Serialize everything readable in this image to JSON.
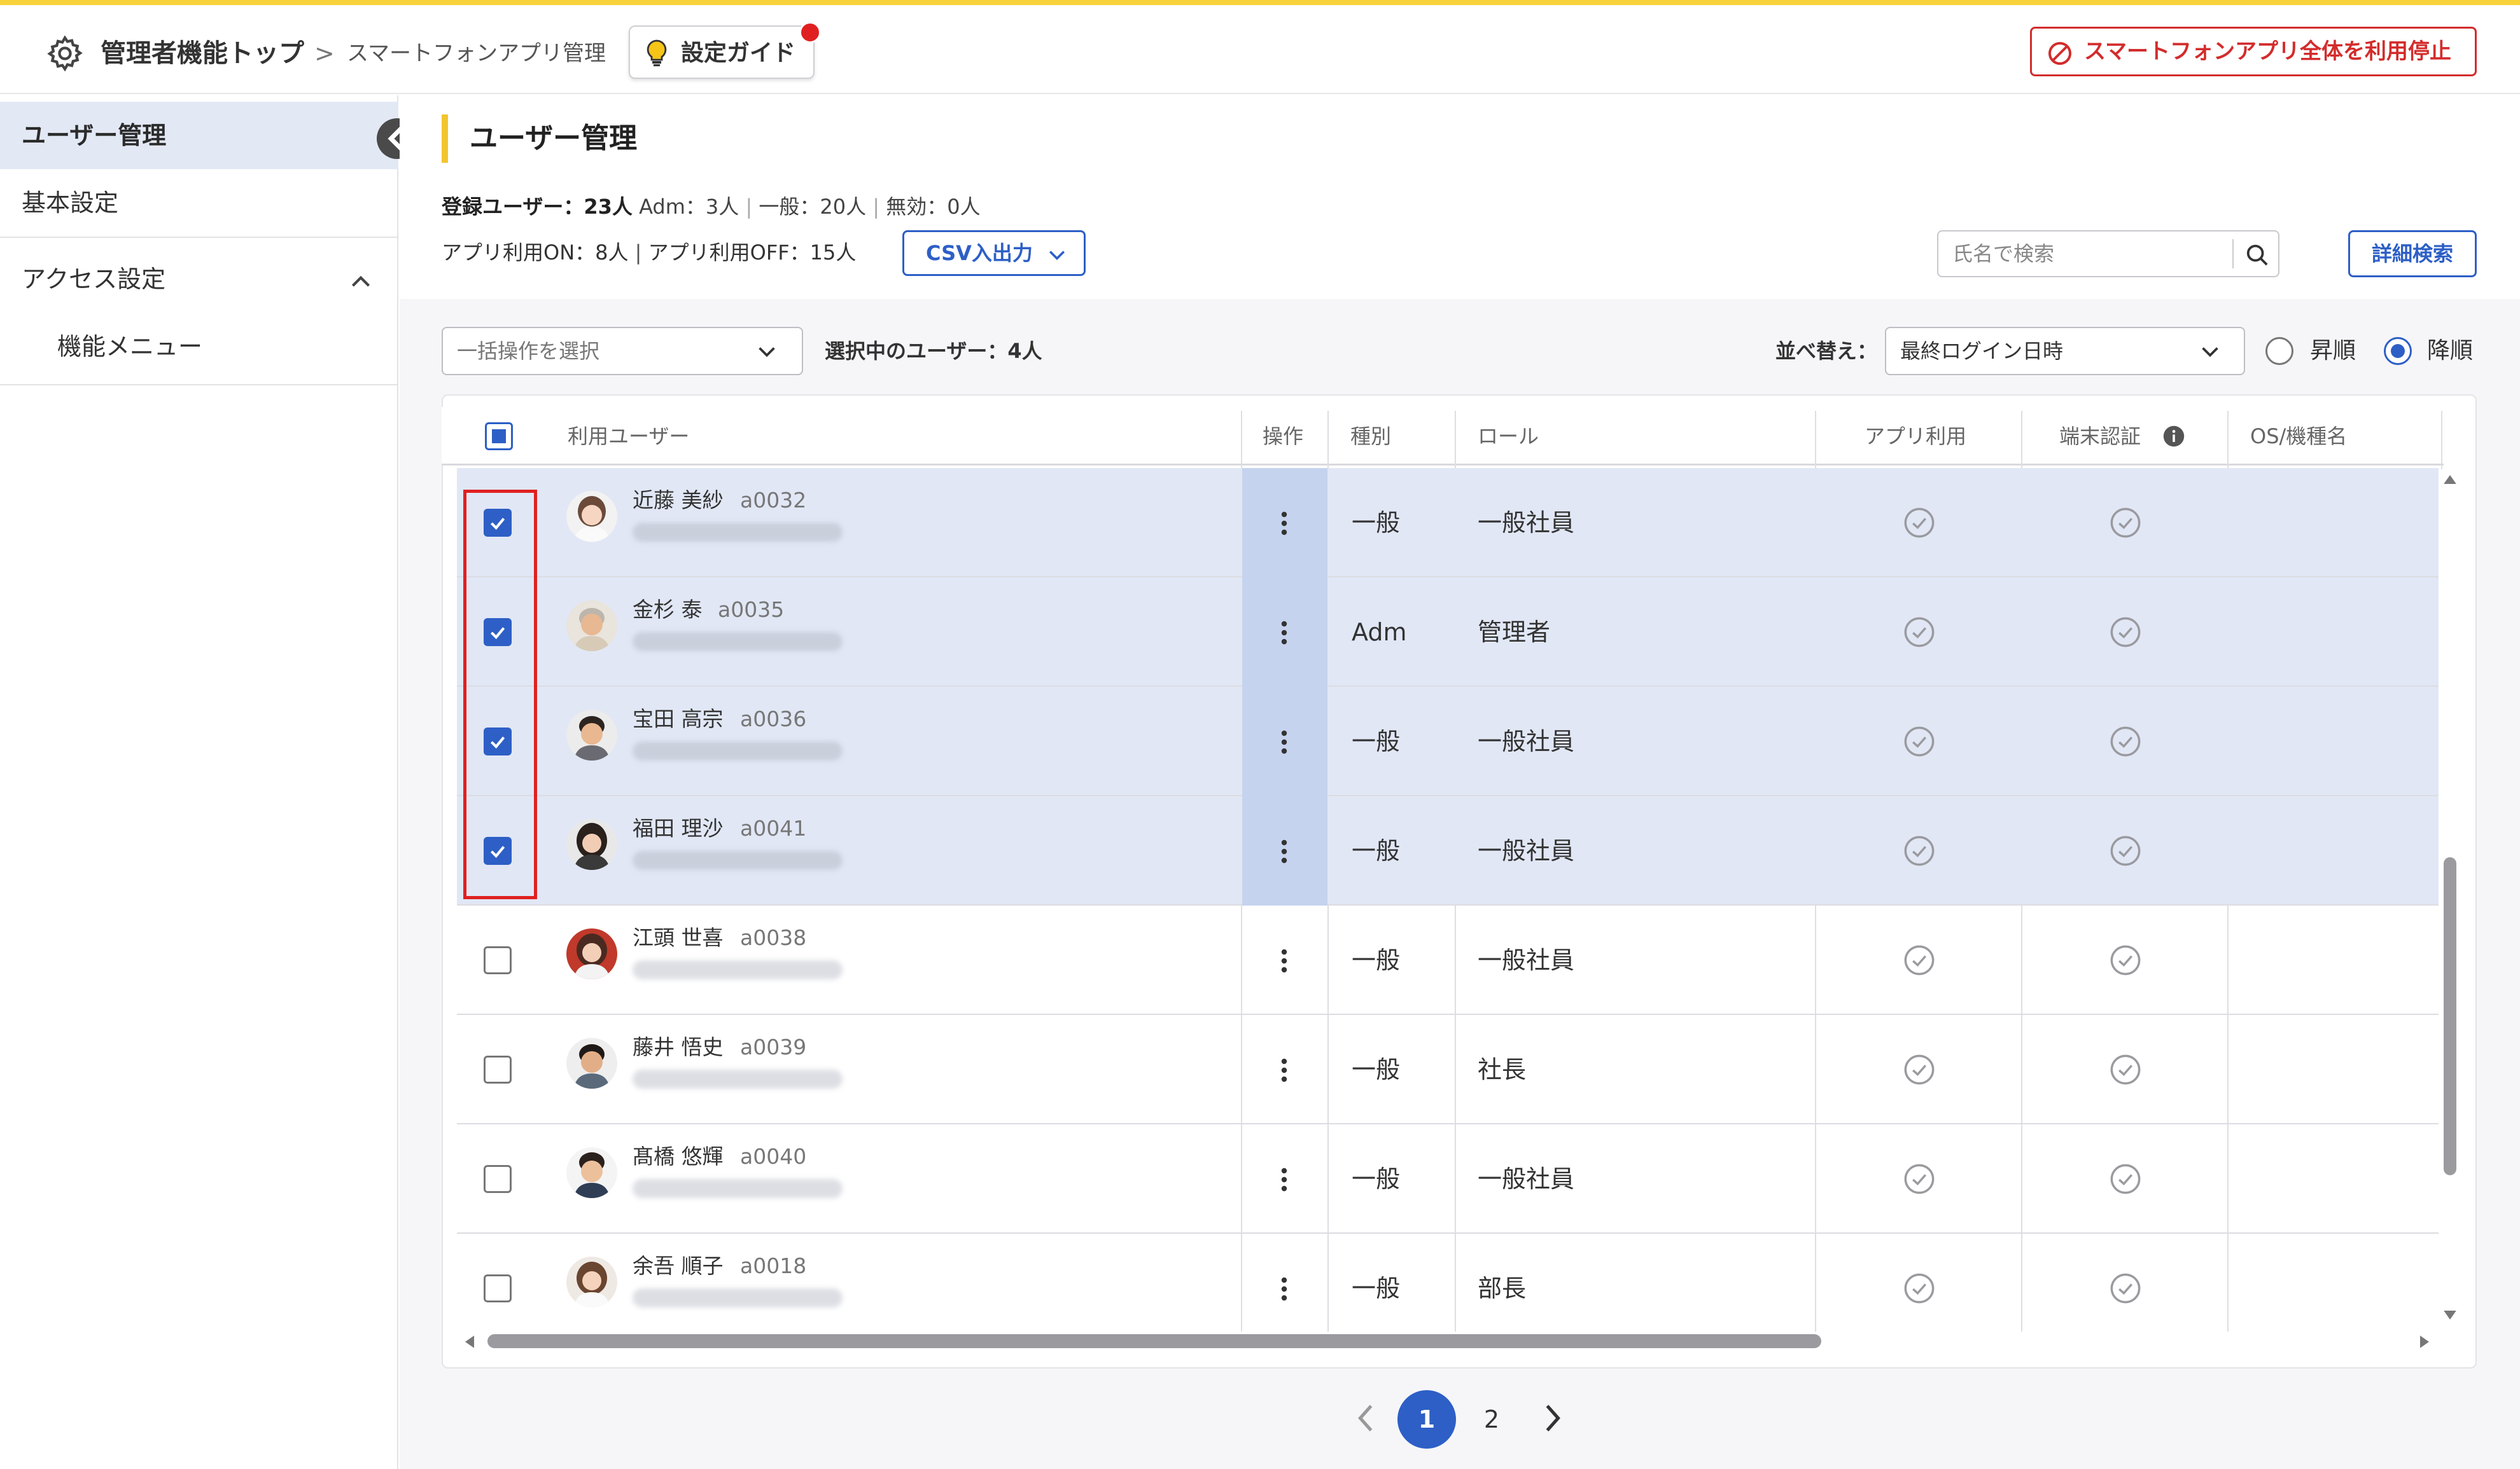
{
  "header": {
    "title": "管理者機能トップ",
    "separator": ">",
    "breadcrumb": "スマートフォンアプリ管理",
    "guide_button": "設定ガイド",
    "stop_button": "スマートフォンアプリ全体を利用停止"
  },
  "sidebar": {
    "items": [
      {
        "label": "ユーザー管理"
      },
      {
        "label": "基本設定"
      },
      {
        "label": "アクセス設定"
      },
      {
        "label": "機能メニュー"
      }
    ]
  },
  "main": {
    "title": "ユーザー管理",
    "stats": {
      "registered": "登録ユーザー：23人",
      "adm": "Adm：3人",
      "general": "一般：20人",
      "invalid": "無効：0人",
      "app_on": "アプリ利用ON：8人",
      "app_off": "アプリ利用OFF：15人"
    },
    "csv_button": "CSV入出力",
    "search_placeholder": "氏名で検索",
    "detail_search": "詳細検索",
    "bulk_placeholder": "一括操作を選択",
    "selected_count": "選択中のユーザー：4人",
    "sort_label": "並べ替え：",
    "sort_value": "最終ログイン日時",
    "order_asc": "昇順",
    "order_desc": "降順"
  },
  "table": {
    "headers": {
      "user": "利用ユーザー",
      "op": "操作",
      "type": "種別",
      "role": "ロール",
      "app": "アプリ利用",
      "device": "端末認証",
      "os": "OS/機種名"
    },
    "rows": [
      {
        "name": "近藤 美紗",
        "id": "a0032",
        "type": "一般",
        "role": "一般社員",
        "checked": true
      },
      {
        "name": "金杉 泰",
        "id": "a0035",
        "type": "Adm",
        "role": "管理者",
        "checked": true
      },
      {
        "name": "宝田 高宗",
        "id": "a0036",
        "type": "一般",
        "role": "一般社員",
        "checked": true
      },
      {
        "name": "福田 理沙",
        "id": "a0041",
        "type": "一般",
        "role": "一般社員",
        "checked": true
      },
      {
        "name": "江頭 世喜",
        "id": "a0038",
        "type": "一般",
        "role": "一般社員",
        "checked": false
      },
      {
        "name": "藤井 悟史",
        "id": "a0039",
        "type": "一般",
        "role": "社長",
        "checked": false
      },
      {
        "name": "髙橋 悠輝",
        "id": "a0040",
        "type": "一般",
        "role": "一般社員",
        "checked": false
      },
      {
        "name": "余吾 順子",
        "id": "a0018",
        "type": "一般",
        "role": "部長",
        "checked": false
      }
    ]
  },
  "pagination": {
    "pages": [
      "1",
      "2"
    ],
    "current": "1"
  },
  "colors": {
    "accent": "#2d5fc6",
    "warning": "#d32c2c",
    "highlight_bar": "#f2c52e",
    "selected_row": "#e1e7f5"
  }
}
